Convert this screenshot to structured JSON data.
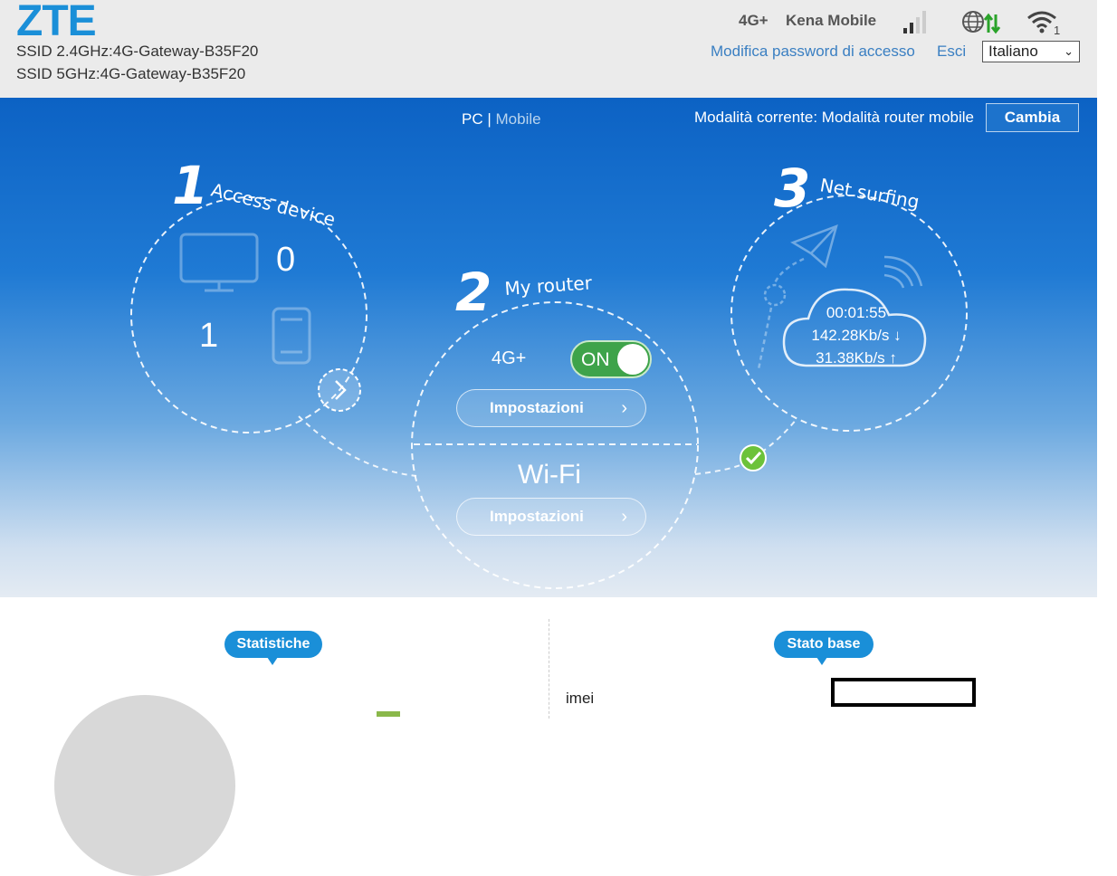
{
  "header": {
    "logo": "ZTE",
    "ssid_24": "SSID 2.4GHz:4G-Gateway-B35F20",
    "ssid_5": "SSID 5GHz:4G-Gateway-B35F20",
    "network_type": "4G+",
    "carrier": "Kena Mobile",
    "wifi_clients": "1",
    "change_password": "Modifica password di accesso",
    "logout": "Esci",
    "language": "Italiano"
  },
  "hero": {
    "view_pc": "PC",
    "view_sep": "|",
    "view_mobile": "Mobile",
    "current_mode": "Modalità corrente: Modalità router mobile",
    "change_button": "Cambia",
    "step1_number": "1",
    "step1_title": "Access device",
    "wired_count": "0",
    "wireless_count": "1",
    "step2_number": "2",
    "step2_title": "My router",
    "mobile_label": "4G+",
    "mobile_toggle": "ON",
    "mobile_settings": "Impostazioni",
    "wifi_label": "Wi-Fi",
    "wifi_settings": "Impostazioni",
    "step3_number": "3",
    "step3_title": "Net surfing",
    "connected_time": "00:01:55",
    "download_speed": "142.28Kb/s ↓",
    "upload_speed": "31.38Kb/s ↑"
  },
  "bottom": {
    "stats_title": "Statistiche",
    "base_title": "Stato base",
    "imei_label": "imei",
    "imei_value": ""
  },
  "colors": {
    "accent": "#1a8fd8",
    "toggle_on": "#3ea34a",
    "link": "#3a7fc2"
  }
}
